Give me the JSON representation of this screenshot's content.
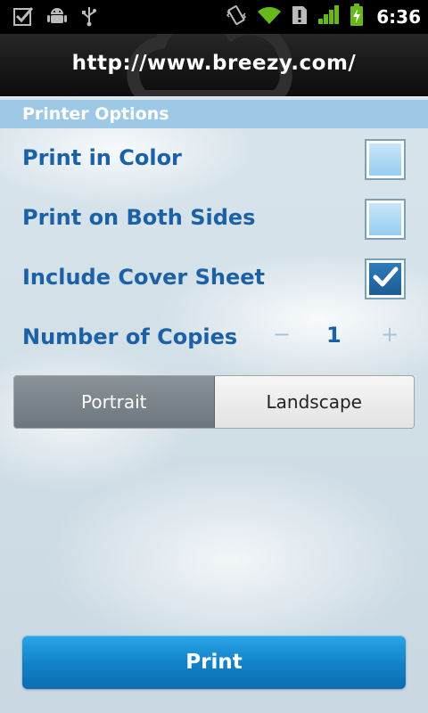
{
  "status_bar": {
    "time": "6:36",
    "icons": [
      "checkbox-notification-icon",
      "android-icon",
      "usb-icon",
      "vibrate-icon",
      "wifi-icon",
      "alert-icon",
      "signal-icon",
      "battery-charging-icon"
    ]
  },
  "header": {
    "url": "http://www.breezy.com/"
  },
  "section": {
    "title": "Printer Options"
  },
  "options": {
    "color": {
      "label": "Print in Color",
      "checked": false
    },
    "duplex": {
      "label": "Print on Both Sides",
      "checked": false
    },
    "cover": {
      "label": "Include Cover Sheet",
      "checked": true
    },
    "copies": {
      "label": "Number of Copies",
      "value": "1",
      "minus": "−",
      "plus": "+"
    }
  },
  "orientation": {
    "portrait": "Portrait",
    "landscape": "Landscape",
    "selected": "Portrait"
  },
  "print_button": {
    "label": "Print"
  },
  "colors": {
    "accent": "#1c61a6",
    "section_header": "#9ec9e6",
    "button": "#1383c9"
  }
}
